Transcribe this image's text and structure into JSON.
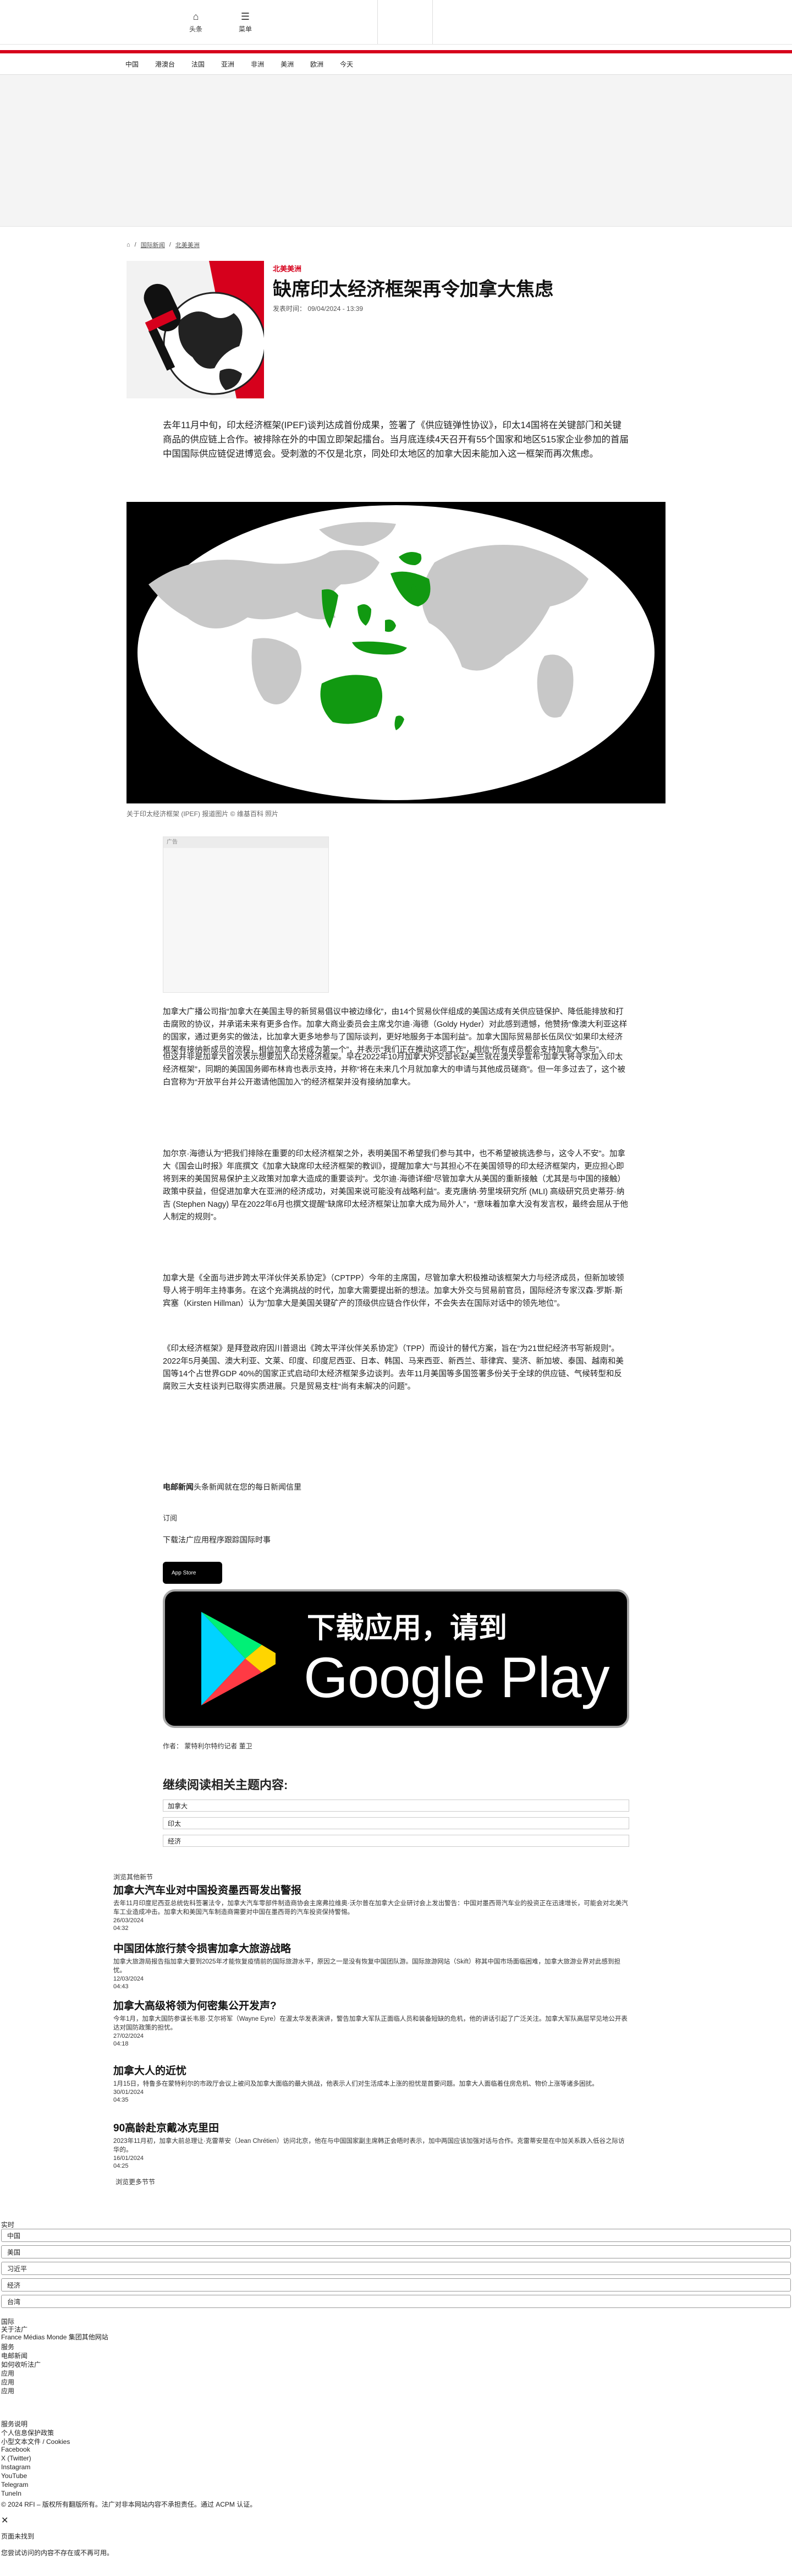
{
  "header": {
    "home_label": "头条",
    "menu_label": "菜单",
    "nav": [
      "中国",
      "港澳台",
      "法国",
      "亚洲",
      "非洲",
      "美洲",
      "欧洲",
      "今天"
    ]
  },
  "breadcrumb": {
    "items": [
      "国际新闻",
      "北美美洲"
    ]
  },
  "article": {
    "section": "北美美洲",
    "title": "缺席印太经济框架再令加拿大焦虑",
    "meta": "发表时间： 09/04/2024 - 13:39",
    "lead": "去年11月中旬，印太经济框架(IPEF)谈判达成首份成果，签署了《供应链弹性协议》，印太14国将在关键部门和关键商品的供应链上合作。被排除在外的中国立即架起擂台。当月底连续4天召开有55个国家和地区515家企业参加的首届中国国际供应链促进博览会。受刺激的不仅是北京，同处印太地区的加拿大因未能加入这一框架而再次焦虑。",
    "image_caption": "关于印太经济框架 (IPEF) 报道图片 © 维基百科 照片",
    "ad_label": "广告",
    "paragraphs": [
      "加拿大广播公司指“加拿大在美国主导的新贸易倡议中被边缘化”，由14个贸易伙伴组成的美国达成有关供应链保护、降低能排放和打击腐败的协议，并承诺未来有更多合作。加拿大商业委员会主席戈尔迪·海德（Goldy Hyder）对此感到遗憾，他赞扬“像澳大利亚这样的国家，通过更务实的做法，比加拿大更多地参与了国际谈判，更好地服务于本国利益”。加拿大国际贸易部长伍凤仪“如果印太经济框架有接纳新成员的流程，相信加拿大将成为第一个”，并表示“我们正在推动这项工作”，相信“所有成员都会支持加拿大参与”。",
      "但这并非是加拿大首次表示想要加入印太经济框架。早在2022年10月加拿大外交部长赵美兰就在澳大学宣布“加拿大将寻求加入印太经济框架”，同期的美国国务卿布林肯也表示支持，并称“将在未来几个月就加拿大的申请与其他成员磋商”。但一年多过去了，这个被白宫称为“开放平台并公开邀请他国加入”的经济框架并没有接纳加拿大。",
      "加尔京·海德认为“把我们排除在重要的印太经济框架之外，表明美国不希望我们参与其中，也不希望被挑选参与，这令人不安”。加拿大《国会山时报》年底撰文《加拿大缺席印太经济框架的教训》，提醒加拿大“与其担心不在美国领导的印太经济框架内，更应担心即将到来的美国贸易保护主义政策对加拿大造成的重要谈判”。戈尔迪·海德详细“尽管加拿大从美国的重新接触（尤其是与中国的接触）政策中获益，但促进加拿大在亚洲的经济成功，对美国来说可能没有战略利益”。麦克唐纳·劳里埃研究所 (MLI) 高级研究员史蒂芬·纳吉 (Stephen Nagy) 早在2022年6月也撰文提醒“缺席印太经济框架让加拿大成为局外人”，“意味着加拿大没有发言权，最终会屈从于他人制定的规则”。",
      "加拿大是《全面与进步跨太平洋伙伴关系协定》（CPTPP）今年的主席国，尽管加拿大积极推动该框架大力与经济成员，但新加坡领导人将于明年主持事务。在这个充满挑战的时代，加拿大需要提出新的想法。加拿大外交与贸易前官员，国际经济专家汉森·罗斯·斯宾塞（Kirsten Hillman）认为“加拿大是美国关键矿产的顶级供应链合作伙伴，不会失去在国际对话中的领先地位”。",
      "《印太经济框架》是拜登政府因川普退出《跨太平洋伙伴关系协定》（TPP）而设计的替代方案，旨在“为21世纪经济书写新规则”。2022年5月美国、澳大利亚、文莱、印度、印度尼西亚、日本、韩国、马来西亚、新西兰、菲律宾、斐济、新加坡、泰国、越南和美国等14个占世界GDP 40%的国家正式启动印太经济框架多边谈判。去年11月美国等多国签署多份关于全球的供应链、气候转型和反腐败三大支柱谈判已取得实质进展。只是贸易支柱“尚有未解决的问题”。"
    ],
    "sign_bold": "电邮新闻",
    "sign_rest": "头条新闻就在您的每日新闻信里",
    "subscribe": "订阅",
    "app_promo": "下载法广应用程序跟踪国际时事",
    "appstore": "App Store",
    "gplay_line1": "下载应用，请到",
    "gplay_line2": "Google Play",
    "author": "作者： 蒙特利尔特约记者 董卫"
  },
  "topics": {
    "heading": "继续阅读相关主题内容:",
    "items": [
      "加拿大",
      "印太",
      "经济"
    ]
  },
  "related": {
    "label": "浏览其他新节",
    "items": [
      {
        "title": "加拿大汽车业对中国投资墨西哥发出警报",
        "text": "去年11月印度尼西亚总统佐科签署法令，加拿大汽车零部件制造商协会主席弗拉维奥·沃尔普在加拿大企业研讨会上发出警告：中国对墨西哥汽车业的投资正在迅速增长，可能会对北美汽车工业造成冲击。加拿大和美国汽车制造商需要对中国在墨西哥的汽车投资保持警惕。",
        "date": "26/03/2024",
        "time": "04:32"
      },
      {
        "title": "中国团体旅行禁令损害加拿大旅游战略",
        "text": "加拿大旅游局报告指加拿大要到2025年才能恢复疫情前的国际旅游水平，原因之一是没有恢复中国团队游。国际旅游网站（Skift）称其中国市场面临困难，加拿大旅游业界对此感到担忧。",
        "date": "12/03/2024",
        "time": "04:43"
      },
      {
        "title": "加拿大高级将领为何密集公开发声?",
        "text": "今年1月，加拿大国防参谋长韦恩·艾尔将军（Wayne Eyre）在渥太华发表演讲，警告加拿大军队正面临人员和装备短缺的危机，他的讲话引起了广泛关注。加拿大军队高层罕见地公开表达对国防政策的担忧。",
        "date": "27/02/2024",
        "time": "04:18"
      },
      {
        "title": "加拿大人的近忧",
        "text": "1月15日，特鲁多在蒙特利尔的市政厅会议上被问及加拿大面临的最大挑战，他表示人们对生活成本上涨的担忧是首要问题。加拿大人面临着住房危机、物价上涨等诸多困扰。",
        "date": "30/01/2024",
        "time": "04:35"
      },
      {
        "title": "90高龄赴京戴冰克里田",
        "text": "2023年11月初，加拿大前总理让·克雷蒂安（Jean Chrétien）访问北京，他在与中国国家副主席韩正会晤时表示，加中两国应该加强对话与合作。克雷蒂安是在中加关系跌入低谷之际访华的。",
        "date": "16/01/2024",
        "time": "04:25"
      }
    ],
    "more": "浏览更多节节"
  },
  "footer": {
    "live_label": "实时",
    "languages": [
      "中国",
      "美国",
      "习近平",
      "经济",
      "台湾"
    ],
    "links": [
      "国际",
      "关于法广",
      "France Médias Monde 集团其他网站",
      "服务",
      "电邮新闻",
      "如何收听法广",
      "应用",
      "应用",
      "应用"
    ],
    "links2": [
      "服务说明",
      "个人信息保护政策",
      "小型文本文件 / Cookies",
      "Facebook",
      "X (Twitter)",
      "Instagram",
      "YouTube",
      "Telegram",
      "TuneIn"
    ],
    "copyright": "© 2024 RFI – 版权所有翻版所有。法广对非本网站内容不承担责任。通过 ACPM 认证。",
    "notfound_title": "页面未找到",
    "notfound_text": "您尝试访问的内容不存在或不再可用。"
  }
}
